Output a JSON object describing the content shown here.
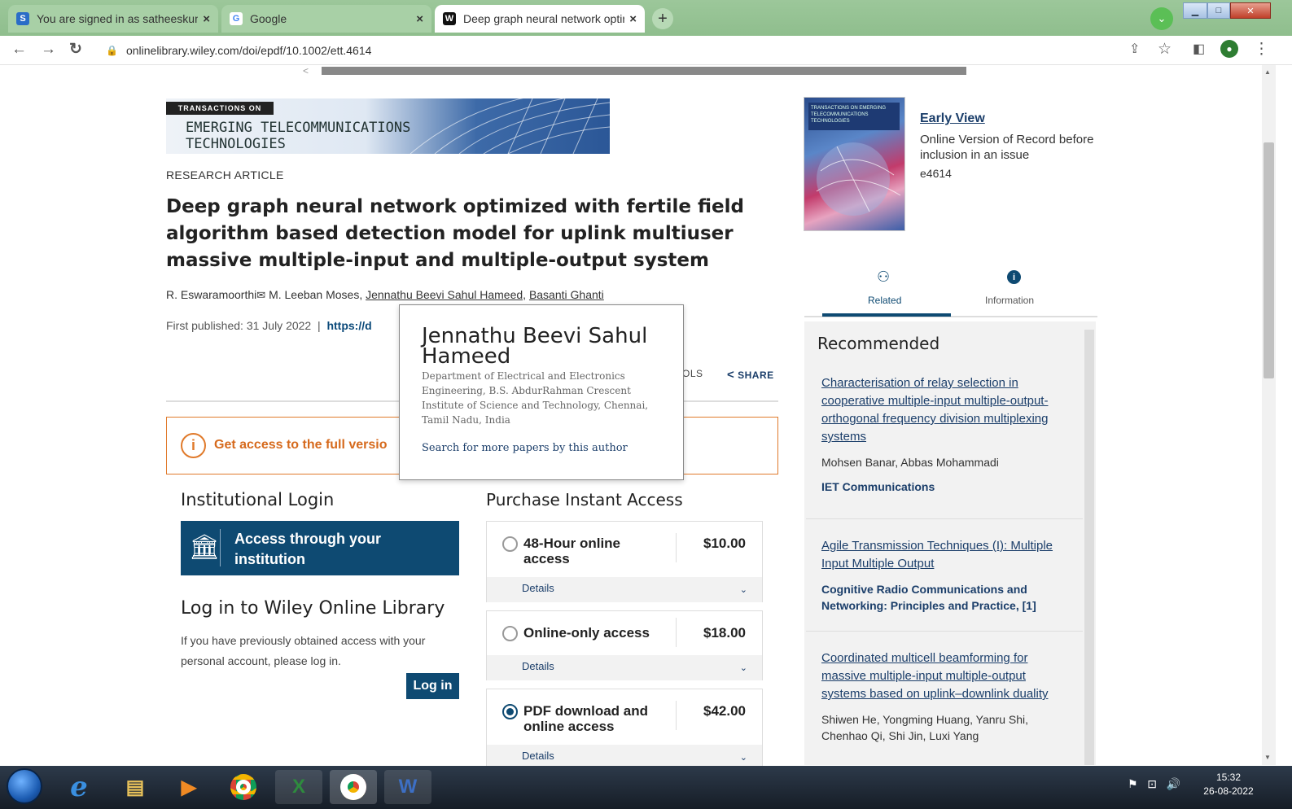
{
  "browser": {
    "tabs": [
      {
        "icon": "S",
        "title": "You are signed in as satheeskum"
      },
      {
        "icon": "G",
        "title": "Google"
      },
      {
        "icon": "W",
        "title": "Deep graph neural network optir"
      }
    ],
    "url": "onlinelibrary.wiley.com/doi/epdf/10.1002/ett.4614"
  },
  "carousel": {
    "prev_glyph": "<"
  },
  "article": {
    "banner_tag": "TRANSACTIONS ON",
    "banner_name_line1": "EMERGING TELECOMMUNICATIONS",
    "banner_name_line2": "TECHNOLOGIES",
    "type": "RESEARCH ARTICLE",
    "title": "Deep graph neural network optimized with fertile field algorithm based detection model for uplink multiuser massive multiple-input and multiple-output system",
    "authors": [
      "R. Eswaramoorthi",
      "M. Leeban Moses,",
      "Jennathu Beevi Sahul Hameed,",
      "Basanti Ghanti"
    ],
    "first_published_label": "First published:",
    "first_published_date": "31 July 2022",
    "doi_partial": "https://d",
    "tools_partial": "OLS",
    "share_label": "SHARE"
  },
  "access_banner": {
    "text": "Get access to the full versio"
  },
  "author_popover": {
    "name": "Jennathu Beevi Sahul Hameed",
    "affiliation": "Department of Electrical and Electronics Engineering, B.S. AbdurRahman Crescent Institute of Science and Technology, Chennai, Tamil Nadu, India",
    "search_link": "Search for more papers by this author"
  },
  "institutional": {
    "heading": "Institutional Login",
    "button_label": "Access through your institution"
  },
  "wiley_login": {
    "heading": "Log in to Wiley Online Library",
    "text": "If you have previously obtained access with your personal account, please log in.",
    "button": "Log in"
  },
  "purchase": {
    "heading": "Purchase Instant Access",
    "options": [
      {
        "label": "48-Hour online access",
        "price": "$10.00",
        "details": "Details",
        "selected": false
      },
      {
        "label": "Online-only access",
        "price": "$18.00",
        "details": "Details",
        "selected": false
      },
      {
        "label": "PDF download and online access",
        "price": "$42.00",
        "details": "Details",
        "selected": true
      }
    ]
  },
  "sidebar": {
    "cover_text": "TRANSACTIONS ON EMERGING TELECOMMUNICATIONS TECHNOLOGIES",
    "early_view": "Early View",
    "version_text": "Online Version of Record before inclusion in an issue",
    "article_number": "e4614",
    "tabs": [
      {
        "label": "Related",
        "active": true
      },
      {
        "label": "Information",
        "active": false
      }
    ],
    "recommended_heading": "Recommended",
    "recommended": [
      {
        "title": "Characterisation of relay selection in cooperative multiple-input multiple-output-orthogonal frequency division multiplexing systems",
        "authors": "Mohsen Banar, Abbas Mohammadi",
        "journal": "IET Communications"
      },
      {
        "title": "Agile Transmission Techniques (I): Multiple Input Multiple Output",
        "authors": "",
        "journal": "Cognitive Radio Communications and Networking: Principles and Practice, [1]"
      },
      {
        "title": "Coordinated multicell beamforming for massive multiple-input multiple-output systems based on uplink–downlink duality",
        "authors": "Shiwen He, Yongming Huang, Yanru Shi, Chenhao Qi, Shi Jin, Luxi Yang",
        "journal": ""
      }
    ]
  },
  "taskbar": {
    "time": "15:32",
    "date": "26-08-2022"
  },
  "colors": {
    "brand": "#0e4a72",
    "access_orange": "#e07a2b",
    "chrome_green": "#8fbe8d"
  }
}
